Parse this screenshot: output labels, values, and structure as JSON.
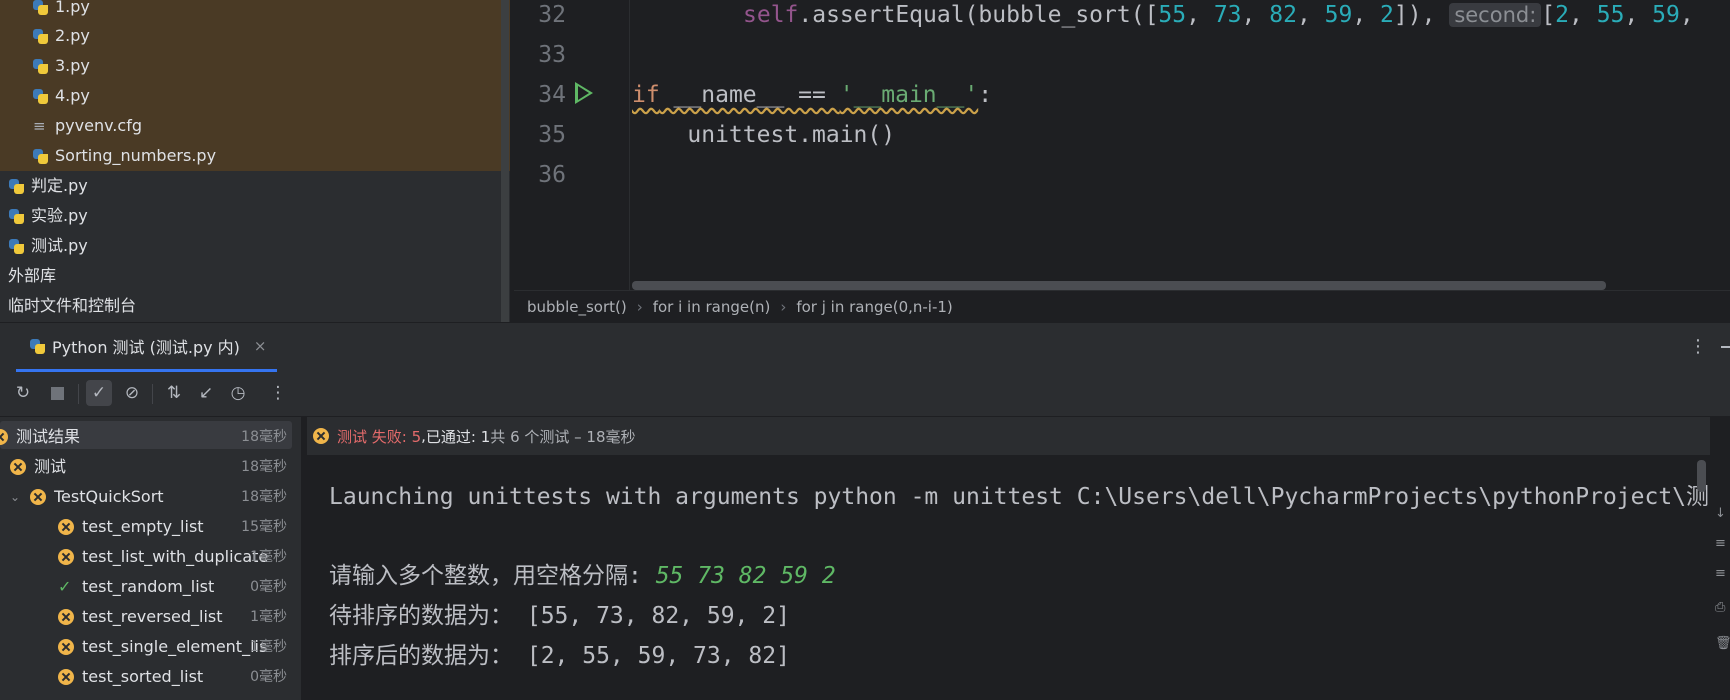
{
  "project": {
    "files": [
      {
        "name": "1.py",
        "type": "py"
      },
      {
        "name": "2.py",
        "type": "py"
      },
      {
        "name": "3.py",
        "type": "py"
      },
      {
        "name": "4.py",
        "type": "py"
      },
      {
        "name": "pyvenv.cfg",
        "type": "cfg"
      },
      {
        "name": "Sorting_numbers.py",
        "type": "py"
      }
    ],
    "root_files": [
      {
        "name": "判定.py"
      },
      {
        "name": "实验.py"
      },
      {
        "name": "测试.py"
      }
    ],
    "external_libs": "外部库",
    "scratches": "临时文件和控制台"
  },
  "editor": {
    "lines": [
      {
        "num": "32"
      },
      {
        "num": "33"
      },
      {
        "num": "34"
      },
      {
        "num": "35"
      },
      {
        "num": "36"
      }
    ],
    "line32": {
      "self": "self",
      "call": ".assertEqual(bubble_sort([",
      "n1": "55",
      "n2": "73",
      "n3": "82",
      "n4": "59",
      "n5": "2",
      "close": "]),",
      "hint": "second:",
      "tail_open": "[",
      "t1": "2",
      "t2": "55",
      "t3": "59"
    },
    "line34": {
      "kw": "if",
      "rest": " __name__ == ",
      "str": "'__main__'",
      "colon": ":"
    },
    "line35": "    unittest.main()"
  },
  "breadcrumb": {
    "items": [
      "bubble_sort()",
      "for i in range(n)",
      "for j in range(0,n-i-1)"
    ]
  },
  "tool_tab": {
    "label": "Python 测试 (测试.py 内)",
    "close": "×"
  },
  "tests": {
    "root": {
      "label": "测试结果",
      "time": "18毫秒"
    },
    "module": {
      "label": "测试",
      "time": "18毫秒"
    },
    "suite": {
      "label": "TestQuickSort",
      "time": "18毫秒"
    },
    "items": [
      {
        "label": "test_empty_list",
        "time": "15毫秒",
        "status": "fail"
      },
      {
        "label": "test_list_with_duplicates",
        "time": "1毫秒",
        "status": "fail"
      },
      {
        "label": "test_random_list",
        "time": "0毫秒",
        "status": "pass"
      },
      {
        "label": "test_reversed_list",
        "time": "1毫秒",
        "status": "fail"
      },
      {
        "label": "test_single_element_list",
        "time": "1毫秒",
        "status": "fail"
      },
      {
        "label": "test_sorted_list",
        "time": "0毫秒",
        "status": "fail"
      }
    ]
  },
  "status": {
    "failed": "测试 失败: 5",
    "sep": ", ",
    "passed": "已通过: 1",
    "total": "共 6 个测试 – 18毫秒"
  },
  "console": {
    "launch": "Launching unittests with arguments python -m unittest C:\\Users\\dell\\PycharmProjects\\pythonProject\\测",
    "prompt": "请输入多个整数，用空格分隔: ",
    "input": "55 73 82 59 2",
    "before": "待排序的数据为： [55, 73, 82, 59, 2]",
    "after": "排序后的数据为： [2, 55, 59, 73, 82]"
  },
  "icons": {
    "toolbar": [
      "rerun-failed-icon",
      "stop-icon",
      "show-passed-icon",
      "show-ignored-icon",
      "sort-icon",
      "collapse-icon",
      "history-icon",
      "more-icon"
    ]
  }
}
